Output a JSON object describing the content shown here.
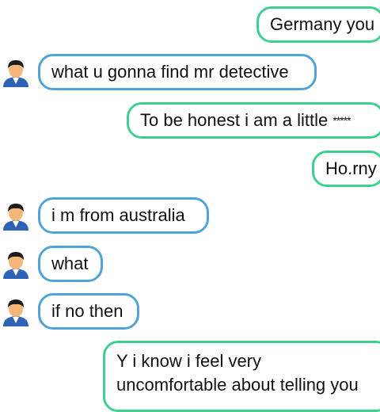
{
  "colors": {
    "sent_border": "#3ecf8e",
    "recv_border": "#4fa3d8",
    "background": "#ffffff",
    "avatar_hair": "#1c1c1c",
    "avatar_face": "#f5b67a",
    "avatar_shirt": "#2f62b5"
  },
  "avatar_icon": "user-avatar-icon",
  "messages": [
    {
      "direction": "sent",
      "text": "Germany you"
    },
    {
      "direction": "received",
      "text": "what u gonna find mr detective"
    },
    {
      "direction": "sent",
      "text": "To be honest i am a little",
      "redacted": "*****"
    },
    {
      "direction": "sent",
      "text": "Ho.rny"
    },
    {
      "direction": "received",
      "text": "i m from australia"
    },
    {
      "direction": "received",
      "text": "what"
    },
    {
      "direction": "received",
      "text": "if no then"
    },
    {
      "direction": "sent",
      "line1": "Y i know i feel very",
      "line2": "uncomfortable about telling you"
    }
  ]
}
